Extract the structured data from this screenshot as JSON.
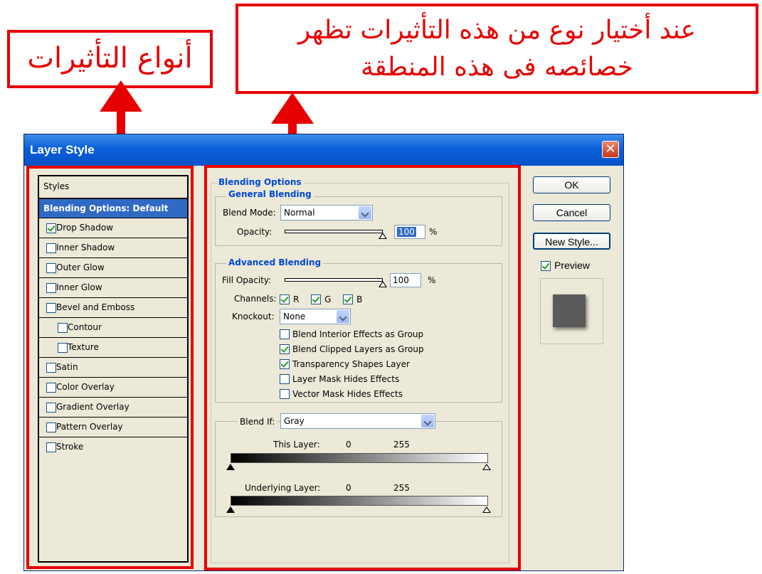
{
  "annotations": {
    "left_label": "أنواع التأثيرات",
    "right_line1": "عند أختيار نوع من هذه التأثيرات تظهر",
    "right_line2": "خصائصه فى هذه المنطقة",
    "color": "#e60000"
  },
  "window": {
    "title": "Layer Style",
    "close_icon": "close-icon"
  },
  "styles_panel": {
    "header": "Styles",
    "selected": "Blending Options: Default",
    "items": [
      {
        "label": "Drop Shadow",
        "checked": true
      },
      {
        "label": "Inner Shadow",
        "checked": false
      },
      {
        "label": "Outer Glow",
        "checked": false
      },
      {
        "label": "Inner Glow",
        "checked": false
      },
      {
        "label": "Bevel and Emboss",
        "checked": false
      },
      {
        "label": "Contour",
        "checked": false
      },
      {
        "label": "Texture",
        "checked": false
      },
      {
        "label": "Satin",
        "checked": false
      },
      {
        "label": "Color Overlay",
        "checked": false
      },
      {
        "label": "Gradient Overlay",
        "checked": false
      },
      {
        "label": "Pattern Overlay",
        "checked": false
      },
      {
        "label": "Stroke",
        "checked": false
      }
    ]
  },
  "blending": {
    "section_title": "Blending Options",
    "general": {
      "title": "General Blending",
      "blend_mode_label": "Blend Mode:",
      "blend_mode_value": "Normal",
      "opacity_label": "Opacity:",
      "opacity_value": "100",
      "opacity_unit": "%"
    },
    "advanced": {
      "title": "Advanced Blending",
      "fill_opacity_label": "Fill Opacity:",
      "fill_opacity_value": "100",
      "fill_opacity_unit": "%",
      "channels_label": "Channels:",
      "channel_r": "R",
      "channel_g": "G",
      "channel_b": "B",
      "knockout_label": "Knockout:",
      "knockout_value": "None",
      "options": [
        {
          "label": "Blend Interior Effects as Group",
          "checked": false
        },
        {
          "label": "Blend Clipped Layers as Group",
          "checked": true
        },
        {
          "label": "Transparency Shapes Layer",
          "checked": true
        },
        {
          "label": "Layer Mask Hides Effects",
          "checked": false
        },
        {
          "label": "Vector Mask Hides Effects",
          "checked": false
        }
      ]
    },
    "blend_if": {
      "label": "Blend If:",
      "value": "Gray",
      "this_layer_label": "This Layer:",
      "this_layer_min": "0",
      "this_layer_max": "255",
      "underlying_label": "Underlying Layer:",
      "underlying_min": "0",
      "underlying_max": "255"
    }
  },
  "buttons": {
    "ok": "OK",
    "cancel": "Cancel",
    "new_style": "New Style...",
    "preview_label": "Preview"
  }
}
